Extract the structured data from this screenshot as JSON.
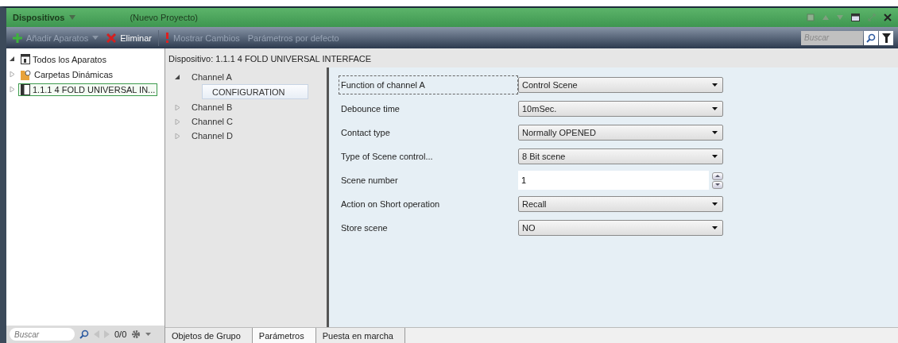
{
  "window": {
    "title": "Dispositivos",
    "subtitle": "(Nuevo Proyecto)"
  },
  "toolbar": {
    "items": [
      {
        "label": "Añadir Aparatos",
        "disabled": true,
        "dropdown": true
      },
      {
        "label": "Eliminar",
        "disabled": false,
        "dropdown": false
      },
      {
        "label": "Mostrar Cambios",
        "disabled": true,
        "dropdown": false
      },
      {
        "label": "Parámetros por defecto",
        "disabled": true,
        "dropdown": false
      }
    ],
    "search": {
      "placeholder": "Buscar"
    }
  },
  "device_tree": [
    {
      "label": "Todos los Aparatos",
      "expanded": true,
      "selected": false
    },
    {
      "label": "Carpetas Dinámicas",
      "expanded": false,
      "selected": false
    },
    {
      "label": "1.1.1  4 FOLD UNIVERSAL IN...",
      "expanded": false,
      "selected": true
    }
  ],
  "left_footer": {
    "search_placeholder": "Buscar",
    "counter": "0/0"
  },
  "device_header": "Dispositivo: 1.1.1  4 FOLD UNIVERSAL INTERFACE",
  "channels": [
    {
      "label": "Channel A",
      "expanded": true,
      "children": [
        {
          "label": "CONFIGURATION",
          "selected": true
        }
      ]
    },
    {
      "label": "Channel B",
      "expanded": false
    },
    {
      "label": "Channel C",
      "expanded": false
    },
    {
      "label": "Channel D",
      "expanded": false
    }
  ],
  "parameters": [
    {
      "label": "Function of channel A",
      "kind": "dropdown",
      "value": "Control Scene",
      "focused": true
    },
    {
      "label": "Debounce time",
      "kind": "dropdown",
      "value": "10mSec.",
      "focused": false
    },
    {
      "label": "Contact type",
      "kind": "dropdown",
      "value": "Normally OPENED",
      "focused": false
    },
    {
      "label": "Type of Scene control...",
      "kind": "dropdown",
      "value": "8 Bit scene",
      "focused": false
    },
    {
      "label": "Scene number",
      "kind": "spinner",
      "value": "1",
      "focused": false
    },
    {
      "label": "Action on Short operation",
      "kind": "dropdown",
      "value": "Recall",
      "focused": false
    },
    {
      "label": "Store scene",
      "kind": "dropdown",
      "value": "NO",
      "focused": false
    }
  ],
  "bottom_tabs": [
    {
      "label": "Objetos de Grupo",
      "selected": false
    },
    {
      "label": "Parámetros",
      "selected": true
    },
    {
      "label": "Puesta en marcha",
      "selected": false
    }
  ]
}
